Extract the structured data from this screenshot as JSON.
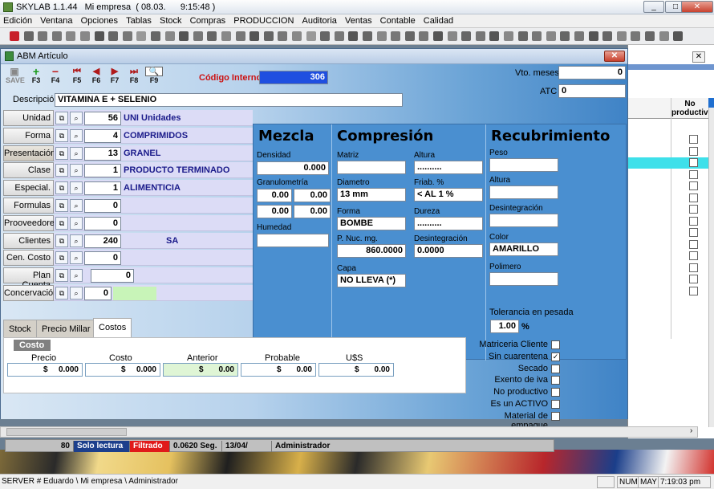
{
  "app": {
    "title": "SKYLAB 1.1.44",
    "company": "Mi empresa",
    "date": "( 08.03.",
    "time": "9:15:48 )",
    "menu": [
      "Edición",
      "Ventana",
      "Opciones",
      "Tablas",
      "Stock",
      "Compras",
      "PRODUCCION",
      "Auditoria",
      "Ventas",
      "Contable",
      "Calidad"
    ],
    "statusbar": {
      "path": "SERVER # Eduardo \\ Mi empresa \\ Administrador",
      "num": "NUM",
      "may": "MAY",
      "clock": "7:19:03 pm"
    }
  },
  "dialog": {
    "title": "ABM Artículo",
    "nav": [
      {
        "label": "SAVE",
        "key": "F3"
      },
      {
        "label": "+",
        "key": "F3"
      },
      {
        "label": "-",
        "key": "F4"
      },
      {
        "label": "|<",
        "key": "F5"
      },
      {
        "label": "<",
        "key": "F6"
      },
      {
        "label": ">",
        "key": "F7"
      },
      {
        "label": ">|",
        "key": "F8"
      },
      {
        "label": "?",
        "key": "F9"
      }
    ],
    "codigo_interno_label": "Código Interno :",
    "codigo_interno": "306",
    "vto_meses_label": "Vto. meses",
    "vto_meses": "0",
    "atc_label": "ATC",
    "atc": "0",
    "descripcion_label": "Descripción",
    "descripcion": "VITAMINA E + SELENIO",
    "rows": [
      {
        "label": "Unidad",
        "code": "56",
        "desc": "UNI Unidades"
      },
      {
        "label": "Forma",
        "code": "4",
        "desc": "COMPRIMIDOS"
      },
      {
        "label": "Presentación",
        "code": "13",
        "desc": "GRANEL"
      },
      {
        "label": "Clase",
        "code": "1",
        "desc": "PRODUCTO TERMINADO"
      },
      {
        "label": "Especial.",
        "code": "1",
        "desc": "ALIMENTICIA"
      },
      {
        "label": "Formulas",
        "code": "0",
        "desc": ""
      },
      {
        "label": "Prooveedores",
        "code": "0",
        "desc": ""
      },
      {
        "label": "Clientes",
        "code": "240",
        "desc": "SA"
      },
      {
        "label": "Cen. Costo",
        "code": "0",
        "desc": ""
      },
      {
        "label": "Plan Cuenta",
        "code": "0",
        "desc": ""
      },
      {
        "label": "Concervación",
        "code": "0",
        "desc": ""
      }
    ],
    "mezcla": {
      "title": "Mezcla",
      "densidad_label": "Densidad",
      "densidad": "0.000",
      "granulometria_label": "Granulometría",
      "granulo": [
        "0.00",
        "0.00",
        "0.00",
        "0.00"
      ],
      "humedad_label": "Humedad",
      "humedad": ""
    },
    "compresion": {
      "title": "Compresión",
      "matriz_label": "Matriz",
      "matriz": "",
      "altura_label": "Altura",
      "altura": "..........",
      "diametro_label": "Diametro",
      "diametro": "13 mm",
      "friab_label": "Friab. %",
      "friab": "< AL 1 %",
      "forma_label": "Forma",
      "forma": "BOMBE",
      "dureza_label": "Dureza",
      "dureza": "..........",
      "pnuc_label": "P. Nuc. mg.",
      "pnuc": "860.0000",
      "desint_label": "Desintegración",
      "desint": "0.0000",
      "capa_label": "Capa",
      "capa": "NO LLEVA (*)"
    },
    "recubrimiento": {
      "title": "Recubrimiento",
      "peso_label": "Peso",
      "peso": "",
      "altura_label": "Altura",
      "altura": "",
      "desint_label": "Desintegración",
      "desint": "",
      "color_label": "Color",
      "color": "AMARILLO",
      "polimero_label": "Polimero",
      "polimero": ""
    },
    "tabs": [
      "Stock",
      "Precio Millar",
      "Costos"
    ],
    "costo": {
      "tag": "Costo",
      "cols": [
        {
          "label": "Precio",
          "sym": "$",
          "value": "0.000"
        },
        {
          "label": "Costo",
          "sym": "$",
          "value": "0.000"
        },
        {
          "label": "Anterior",
          "sym": "$",
          "value": "0.00"
        },
        {
          "label": "Probable",
          "sym": "$",
          "value": "0.00"
        },
        {
          "label": "U$S",
          "sym": "$",
          "value": "0.00"
        }
      ]
    },
    "tolerancia_label": "Tolerancia en pesada",
    "tolerancia": "1.00",
    "tolerancia_unit": "%",
    "checks": [
      {
        "label": "Matriceria Cliente",
        "checked": false
      },
      {
        "label": "Sin cuarentena",
        "checked": true
      },
      {
        "label": "Secado",
        "checked": false
      },
      {
        "label": "Exento de iva",
        "checked": false
      },
      {
        "label": "No productivo",
        "checked": false
      },
      {
        "label": "Es un ACTIVO",
        "checked": false
      },
      {
        "label": "Material de empaque",
        "checked": false
      }
    ],
    "status": {
      "count": "80",
      "mode": "Solo lectura",
      "filter": "Filtrado",
      "time": "0.0620 Seg.",
      "date": "13/04/",
      "user": "Administrador"
    }
  },
  "grid": {
    "header": "No productivo"
  }
}
